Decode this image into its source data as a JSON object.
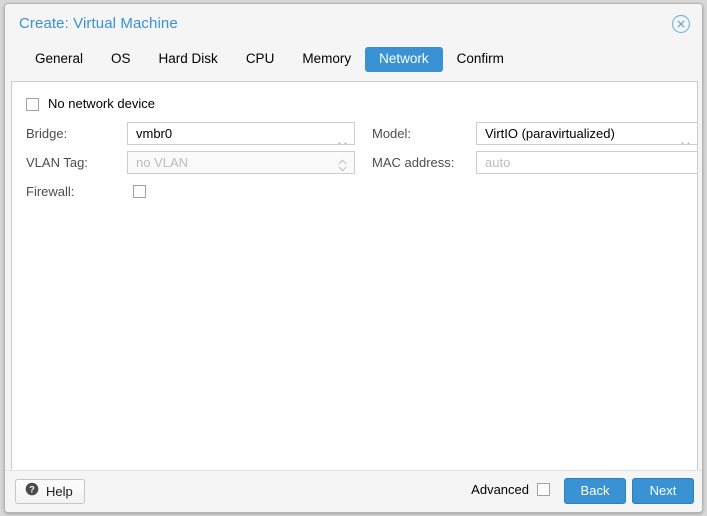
{
  "window": {
    "title": "Create: Virtual Machine",
    "close_icon": "close-circle-icon"
  },
  "tabs": [
    {
      "label": "General",
      "active": false
    },
    {
      "label": "OS",
      "active": false
    },
    {
      "label": "Hard Disk",
      "active": false
    },
    {
      "label": "CPU",
      "active": false
    },
    {
      "label": "Memory",
      "active": false
    },
    {
      "label": "Network",
      "active": true
    },
    {
      "label": "Confirm",
      "active": false
    }
  ],
  "form": {
    "no_network_device": {
      "label": "No network device",
      "checked": false
    },
    "bridge": {
      "label": "Bridge:",
      "value": "vmbr0",
      "icon": "chevron-down-icon"
    },
    "vlan_tag": {
      "label": "VLAN Tag:",
      "value": "",
      "placeholder": "no VLAN",
      "disabled": true,
      "icon": "spinner-updown-icon"
    },
    "firewall": {
      "label": "Firewall:",
      "checked": false
    },
    "model": {
      "label": "Model:",
      "value": "VirtIO (paravirtualized)",
      "icon": "chevron-down-icon"
    },
    "mac_address": {
      "label": "MAC address:",
      "value": "",
      "placeholder": "auto"
    }
  },
  "footer": {
    "help_label": "Help",
    "help_icon": "question-circle-icon",
    "advanced_label": "Advanced",
    "advanced_checked": false,
    "back_label": "Back",
    "next_label": "Next"
  },
  "colors": {
    "accent": "#3892d4",
    "title": "#3892d4",
    "header_bg": "#f5f5f5",
    "content_bg": "#ffffff",
    "label": "#4d4d4d",
    "placeholder": "#bcbcbc"
  }
}
